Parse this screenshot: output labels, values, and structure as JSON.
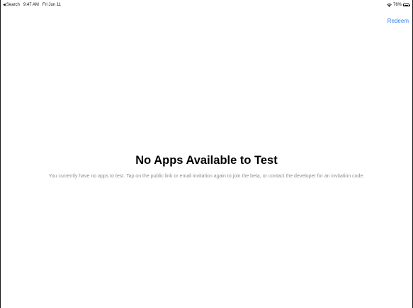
{
  "status_bar": {
    "back_label": "Search",
    "time": "9:47 AM",
    "date": "Fri Jun 11",
    "battery_percent_label": "76%",
    "battery_level": 0.76,
    "wifi_icon": "wifi-icon",
    "battery_icon": "battery-icon"
  },
  "nav": {
    "redeem_label": "Redeem",
    "accent_color": "#2e7cf6"
  },
  "empty_state": {
    "title": "No Apps Available to Test",
    "message": "You currently have no apps to test. Tap on the public link or email invitation again to join the beta, or contact the developer for an invitation code."
  }
}
